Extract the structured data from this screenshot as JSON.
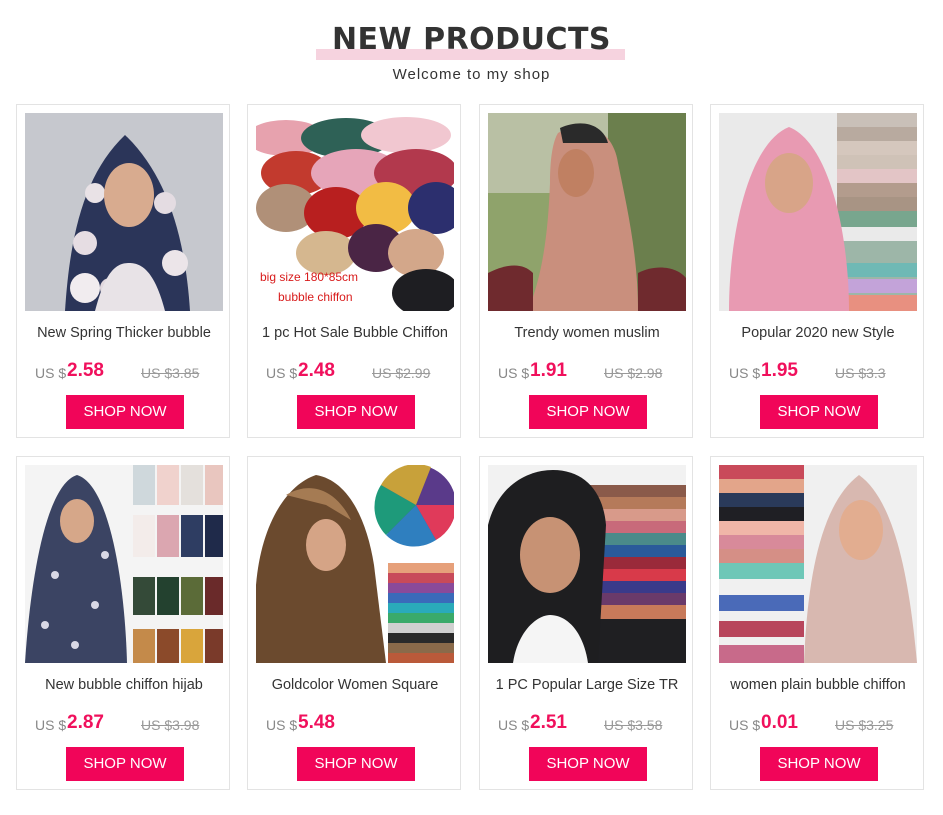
{
  "header": {
    "title": "NEW PRODUCTS",
    "subtitle": "Welcome to my shop"
  },
  "colors": {
    "accent": "#f10559",
    "price": "#f0105c",
    "title_highlight": "#f6d3df"
  },
  "products": [
    {
      "name": "New Spring Thicker bubble",
      "currency": "US $",
      "price": "2.58",
      "old_price": "US $3.85",
      "button": "SHOP NOW",
      "image_text": ""
    },
    {
      "name": "1 pc Hot Sale Bubble Chiffon",
      "currency": "US $",
      "price": "2.48",
      "old_price": "US $2.99",
      "button": "SHOP NOW",
      "image_text": "big size 180*85cm",
      "image_text2": "bubble chiffon"
    },
    {
      "name": "Trendy women muslim",
      "currency": "US $",
      "price": "1.91",
      "old_price": "US $2.98",
      "button": "SHOP NOW",
      "image_text": ""
    },
    {
      "name": "Popular 2020 new Style",
      "currency": "US $",
      "price": "1.95",
      "old_price": "US $3.3",
      "button": "SHOP NOW",
      "image_text": ""
    },
    {
      "name": "New bubble chiffon hijab",
      "currency": "US $",
      "price": "2.87",
      "old_price": "US $3.98",
      "button": "SHOP NOW",
      "image_text": ""
    },
    {
      "name": "Goldcolor Women Square",
      "currency": "US $",
      "price": "5.48",
      "old_price": "",
      "button": "SHOP NOW",
      "image_text": ""
    },
    {
      "name": "1 PC Popular Large Size TR",
      "currency": "US $",
      "price": "2.51",
      "old_price": "US $3.58",
      "button": "SHOP NOW",
      "image_text": ""
    },
    {
      "name": "women plain bubble chiffon",
      "currency": "US $",
      "price": "0.01",
      "old_price": "US $3.25",
      "button": "SHOP NOW",
      "image_text": ""
    }
  ]
}
